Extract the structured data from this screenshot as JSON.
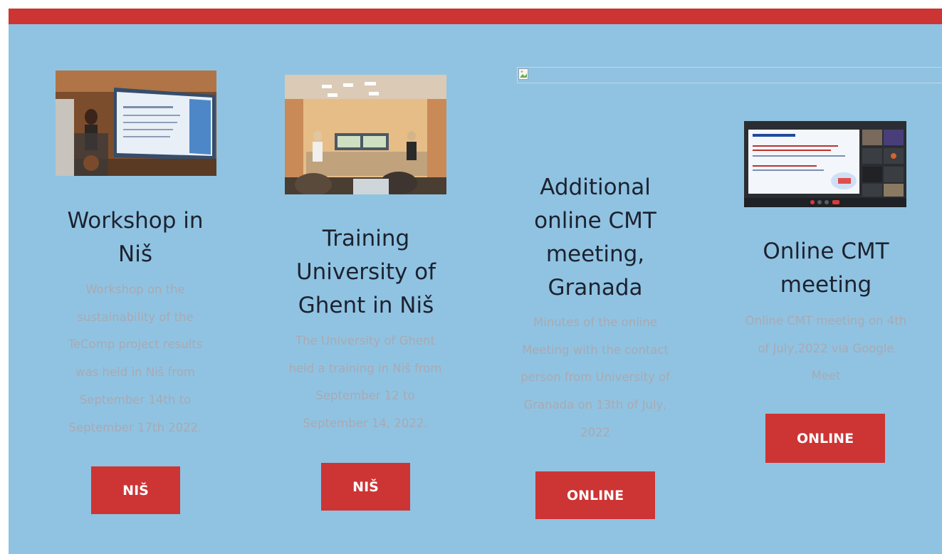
{
  "colors": {
    "accent": "#cd3434",
    "background": "#90c3e1",
    "title": "#1c2230",
    "description": "#a9a9b3"
  },
  "cards": [
    {
      "image": "photo-presentation-projector",
      "title": "Workshop in Niš",
      "description": "Workshop on the sustainability of the TeComp project results was held in Niš from September 14th to September 17th 2022.",
      "button": "NIŠ"
    },
    {
      "image": "photo-training-room",
      "title": "Training University of Ghent in Niš",
      "description": "The University of Ghent held a training in Niš from September 12 to September 14, 2022.",
      "button": "NIŠ"
    },
    {
      "image": "broken-image-icon",
      "title": "Additional online CMT meeting, Granada",
      "description": "Minutes of the online Meeting with the contact person from University of Granada on 13th of July, 2022",
      "button": "ONLINE"
    },
    {
      "image": "screenshot-video-call",
      "title": "Online CMT meeting",
      "description": "Online CMT meeting on 4th of July,2022 via Google Meet",
      "button": "ONLINE"
    }
  ]
}
